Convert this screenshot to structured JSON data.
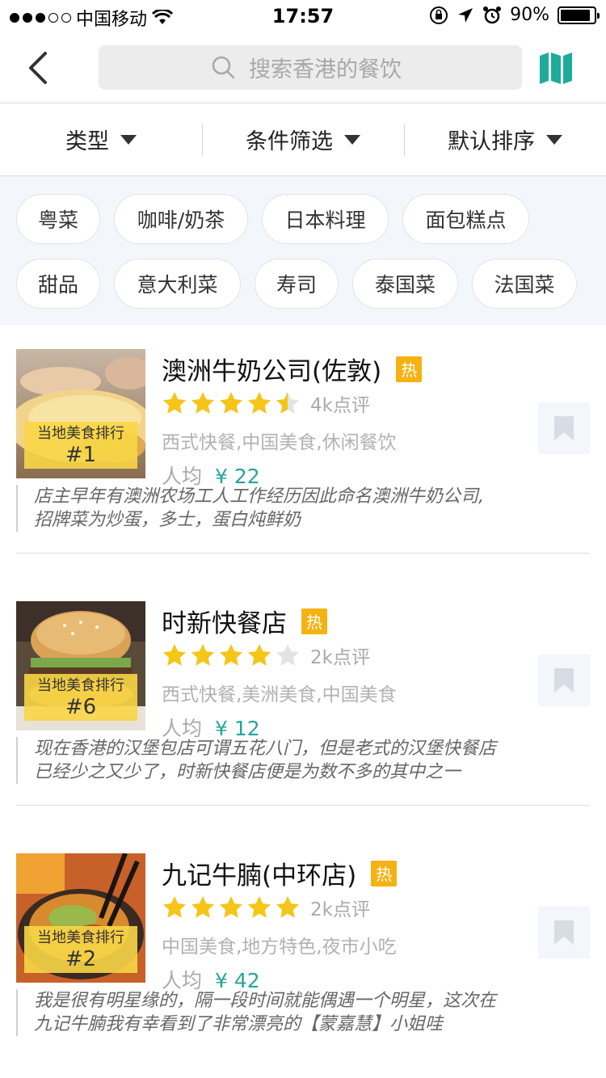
{
  "status_bar": {
    "carrier": "中国移动",
    "time": "17:57",
    "battery": "90%",
    "battery_level": 0.9
  },
  "nav": {
    "search_placeholder": "搜索香港的餐饮"
  },
  "filters": [
    {
      "label": "类型"
    },
    {
      "label": "条件筛选"
    },
    {
      "label": "默认排序"
    }
  ],
  "chips": [
    "粤菜",
    "咖啡/奶茶",
    "日本料理",
    "面包糕点",
    "甜品",
    "意大利菜",
    "寿司",
    "泰国菜",
    "法国菜"
  ],
  "restaurants": [
    {
      "name": "澳洲牛奶公司(佐敦)",
      "hot_badge": "热",
      "rank_label": "当地美食排行",
      "rank": "#1",
      "rating": 4.5,
      "reviews": "4k点评",
      "categories": "西式快餐,中国美食,休闲餐饮",
      "price_label": "人均",
      "price": "¥ 22",
      "quote_line1": "店主早年有澳洲农场工人工作经历因此命名澳洲牛奶公司,",
      "quote_line2": "招牌菜为炒蛋，多士，蛋白炖鲜奶"
    },
    {
      "name": "时新快餐店",
      "hot_badge": "热",
      "rank_label": "当地美食排行",
      "rank": "#6",
      "rating": 4.0,
      "reviews": "2k点评",
      "categories": "西式快餐,美洲美食,中国美食",
      "price_label": "人均",
      "price": "¥ 12",
      "quote_line1": "现在香港的汉堡包店可谓五花八门，但是老式的汉堡快餐店",
      "quote_line2": "已经少之又少了，时新快餐店便是为数不多的其中之一"
    },
    {
      "name": "九记牛腩(中环店)",
      "hot_badge": "热",
      "rank_label": "当地美食排行",
      "rank": "#2",
      "rating": 5.0,
      "reviews": "2k点评",
      "categories": "中国美食,地方特色,夜市小吃",
      "price_label": "人均",
      "price": "¥ 42",
      "quote_line1": "我是很有明星缘的，隔一段时间就能偶遇一个明星，这次在",
      "quote_line2": "九记牛腩我有幸看到了非常漂亮的【蒙嘉慧】小姐哇"
    }
  ],
  "colors": {
    "accent": "#27a59a",
    "star": "#f5c518",
    "hot": "#f5b213",
    "rank_bg": "#f8d646"
  }
}
